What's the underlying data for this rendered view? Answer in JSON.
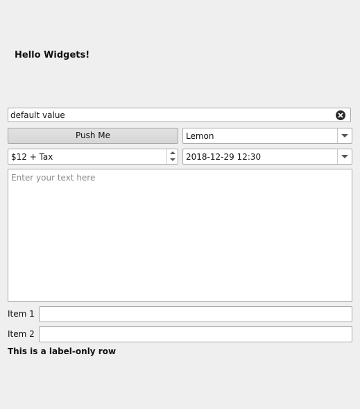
{
  "heading": "Hello Widgets!",
  "line_edit": {
    "value": "default value"
  },
  "push_button": {
    "label": "Push Me"
  },
  "fruit_combo": {
    "selected": "Lemon"
  },
  "price_spin": {
    "value": "$12 + Tax"
  },
  "datetime_combo": {
    "value": "2018-12-29 12:30"
  },
  "text_area": {
    "placeholder": "Enter your text here"
  },
  "form": {
    "rows": [
      {
        "label": "Item 1",
        "value": ""
      },
      {
        "label": "Item 2",
        "value": ""
      }
    ],
    "label_only_row": "This is a label-only row"
  },
  "colors": {
    "window_bg": "#efefef",
    "field_bg": "#ffffff",
    "border": "#a9a9a9",
    "placeholder": "#8a8a8a"
  },
  "icons": {
    "clear": "clear-circle-x-icon",
    "dropdown": "chevron-down-icon",
    "spin_up": "spin-up-arrow-icon",
    "spin_down": "spin-down-arrow-icon"
  }
}
